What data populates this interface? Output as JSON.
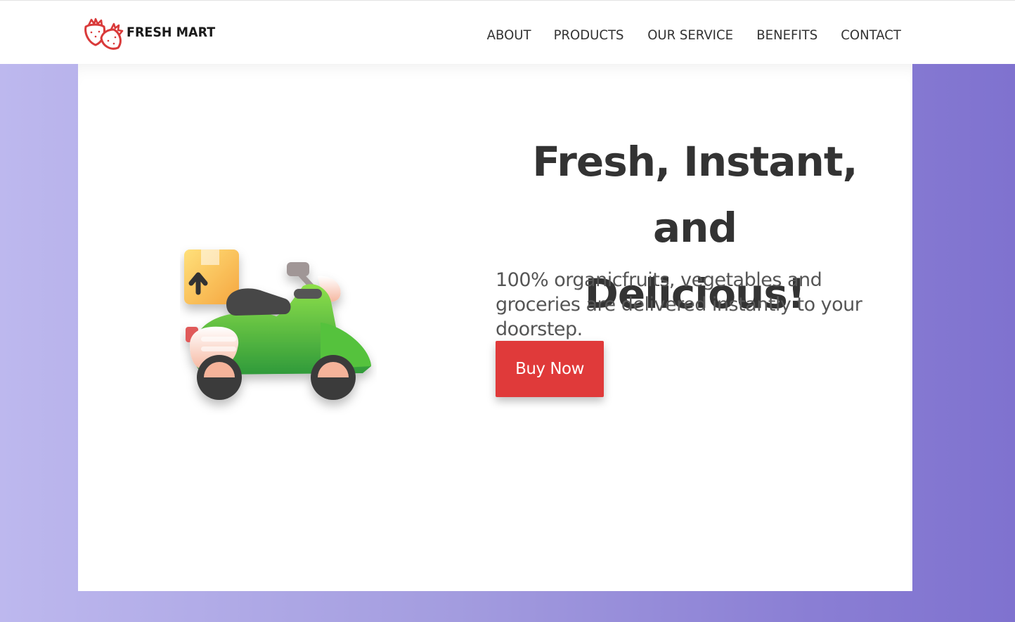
{
  "brand": {
    "name": "FRESH MART",
    "logo_color": "#d93a3a"
  },
  "nav": {
    "items": [
      "ABOUT",
      "PRODUCTS",
      "OUR SERVICE",
      "BENEFITS",
      "CONTACT"
    ]
  },
  "hero": {
    "title_line1": "Fresh, Instant, and",
    "title_line2": "Delicious!",
    "description": "100% organicfruits, vegetables and groceries are delivered instantly to your doorstep.",
    "cta_label": "Buy Now",
    "cta_color": "#e03a3a",
    "image_icon": "delivery-scooter-icon"
  },
  "colors": {
    "background_gradient_start": "#bdb8ee",
    "background_gradient_end": "#7f72cf",
    "text_dark": "#333333"
  }
}
